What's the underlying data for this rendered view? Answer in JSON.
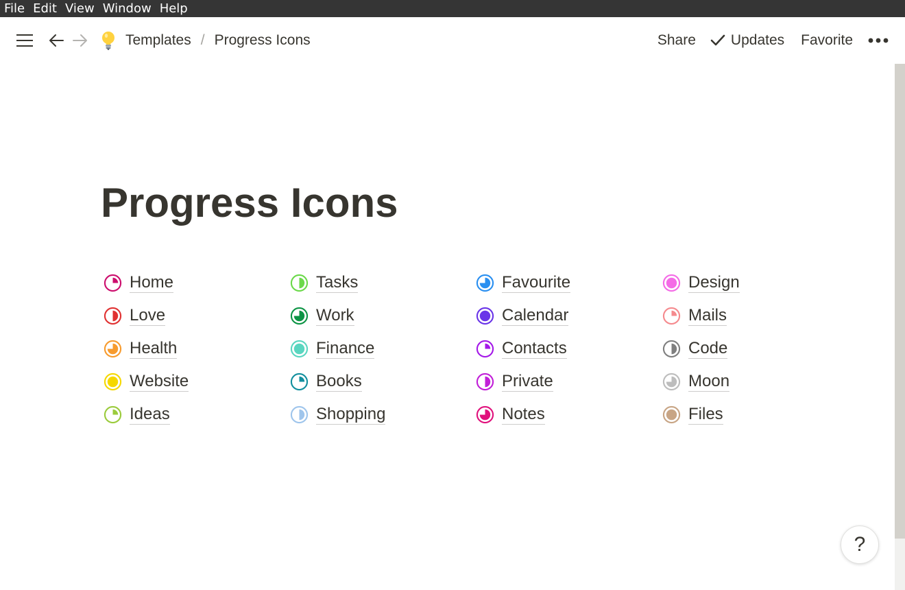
{
  "menubar": {
    "items": [
      "File",
      "Edit",
      "View",
      "Window",
      "Help"
    ]
  },
  "topbar": {
    "breadcrumb": {
      "parent": "Templates",
      "separator": "/",
      "current": "Progress Icons"
    },
    "actions": {
      "share": "Share",
      "updates": "Updates",
      "favorite": "Favorite"
    }
  },
  "page": {
    "title": "Progress Icons"
  },
  "icon_key": {
    "progress": "fraction of ring filled, clockwise from 12 o'clock"
  },
  "links": [
    [
      {
        "label": "Home",
        "color": "#cc0e6d",
        "progress": 0.25
      },
      {
        "label": "Love",
        "color": "#e03232",
        "progress": 0.5
      },
      {
        "label": "Health",
        "color": "#f79b2e",
        "progress": 0.75
      },
      {
        "label": "Website",
        "color": "#f5d800",
        "progress": 1.0
      },
      {
        "label": "Ideas",
        "color": "#9bcb3c",
        "progress": 0.25
      }
    ],
    [
      {
        "label": "Tasks",
        "color": "#6bd94a",
        "progress": 0.5
      },
      {
        "label": "Work",
        "color": "#0d9445",
        "progress": 0.75
      },
      {
        "label": "Finance",
        "color": "#5ad6c0",
        "progress": 1.0
      },
      {
        "label": "Books",
        "color": "#128f9e",
        "progress": 0.25
      },
      {
        "label": "Shopping",
        "color": "#9fc5ec",
        "progress": 0.5
      }
    ],
    [
      {
        "label": "Favourite",
        "color": "#2a8ff0",
        "progress": 0.75
      },
      {
        "label": "Calendar",
        "color": "#6a35e8",
        "progress": 1.0
      },
      {
        "label": "Contacts",
        "color": "#a419e8",
        "progress": 0.25
      },
      {
        "label": "Private",
        "color": "#c11fd8",
        "progress": 0.5
      },
      {
        "label": "Notes",
        "color": "#e0117c",
        "progress": 0.75
      }
    ],
    [
      {
        "label": "Design",
        "color": "#f46be6",
        "progress": 1.0
      },
      {
        "label": "Mails",
        "color": "#f58a8e",
        "progress": 0.25
      },
      {
        "label": "Code",
        "color": "#7f7f7f",
        "progress": 0.5
      },
      {
        "label": "Moon",
        "color": "#bdbdbd",
        "progress": 0.75
      },
      {
        "label": "Files",
        "color": "#c8a585",
        "progress": 1.0
      }
    ]
  ],
  "help": {
    "label": "?"
  }
}
